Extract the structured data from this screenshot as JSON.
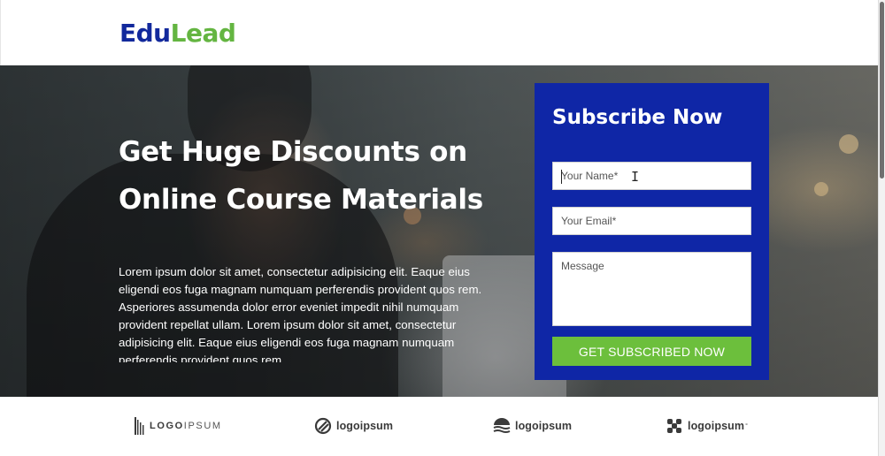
{
  "brand": {
    "part1": "Edu",
    "part2": "Lead"
  },
  "hero": {
    "title": "Get Huge Discounts on Online Course Materials",
    "body": "Lorem ipsum dolor sit amet, consectetur adipisicing elit. Eaque eius eligendi eos fuga magnam numquam perferendis provident quos rem. Asperiores assumenda dolor error eveniet impedit nihil numquam provident repellat ullam. Lorem ipsum dolor sit amet, consectetur adipisicing elit. Eaque eius eligendi eos fuga magnam numquam perferendis provident quos rem."
  },
  "form": {
    "title": "Subscribe Now",
    "name_placeholder": "Your Name*",
    "email_placeholder": "Your Email*",
    "message_placeholder": "Message",
    "submit_label": "GET SUBSCRIBED NOW"
  },
  "partners": {
    "logo1_a": "LOGO",
    "logo1_b": "IPSUM",
    "logo2": "logoipsum",
    "logo3": "logoipsum",
    "logo4": "logoipsum"
  },
  "colors": {
    "brand_blue": "#12299c",
    "brand_green": "#64b541",
    "form_bg": "#0f26a6",
    "button_green": "#6cbf3c"
  }
}
